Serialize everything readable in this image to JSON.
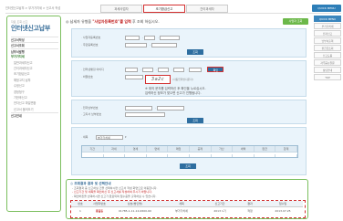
{
  "top": {
    "breadcrumb": "인터넷신고납부 > 부가가치세 > 신고서 작성",
    "tabs": [
      {
        "label": "과세사업자"
      },
      {
        "label": "조기환급신고"
      },
      {
        "label": "간이과세자"
      }
    ],
    "quick": "QUICK MENU"
  },
  "sidebar": {
    "subtitle": "자료 조회·신고",
    "title": "인터넷신고납부",
    "items": [
      {
        "label": "신고서작성",
        "kind": "group"
      },
      {
        "label": "신고서조회",
        "kind": "group"
      },
      {
        "label": "납부서발행",
        "kind": "group"
      },
      {
        "label": "부가가치세",
        "kind": "active"
      },
      {
        "label": "일반과세자신고",
        "kind": "sub"
      },
      {
        "label": "간이과세자신고",
        "kind": "sub"
      },
      {
        "label": "조기환급신고",
        "kind": "sub"
      },
      {
        "label": "예정고지 납부",
        "kind": "sub"
      },
      {
        "label": "수정신고",
        "kind": "sub"
      },
      {
        "label": "경정청구",
        "kind": "sub"
      },
      {
        "label": "기한후신고",
        "kind": "sub"
      },
      {
        "label": "전자신고 파일변환",
        "kind": "sub"
      },
      {
        "label": "신고서 불러오기",
        "kind": "sub"
      },
      {
        "label": "신고안내",
        "kind": "group"
      }
    ]
  },
  "main": {
    "header_prefix": "◎ 납세자 유형을 ",
    "header_highlight": "\"사업자등록번호\"를 입력",
    "header_suffix": " 후 조회 하십시오.",
    "header_button": "사업자 조회",
    "p1": {
      "row1_label": "· 사업자등록번호",
      "row2_label": "· 주민등록번호",
      "button": "조회"
    },
    "p2": {
      "row1_label": "· 인터넷뱅킹 아이디",
      "row2_label": "· 비밀번호",
      "confirm": "확인",
      "captcha": "3a2c",
      "captcha_note": "(자동입력방지문자)",
      "note_line1": "※ 위의 문자를 입력하신 후 확인을 누르십시오.",
      "note_line2": "입력하신 정보가 맞으면 신고가 진행됩니다."
    },
    "p3": {
      "row1_label": "· 전자납부번호",
      "row2_label": "· 고지서 납부번호",
      "button": "조회"
    },
    "p4": {
      "select_label": "· 세목",
      "select_value": "부가가치세",
      "columns": [
        "기간",
        "과세",
        "영세",
        "면세",
        "매입",
        "공제",
        "가산",
        "세액",
        "환급",
        "합계"
      ],
      "row": [
        "",
        "",
        "",
        "",
        "",
        "",
        "",
        "",
        "",
        ""
      ],
      "button": "조회"
    }
  },
  "info": {
    "title": "◎ 조회결과 결과 및 선택안내",
    "line1": "- 조회결과 중 신고하실 건을 선택하시면 신고서 작성 화면으로 이동합니다.",
    "line2": "- 신고기간 및 세목을 확인하신 후 신고서를 작성하여 주시기 바랍니다.",
    "line3": "- 확인버튼을 선택하시면 신고가 완료되며 접수증을 출력하실 수 있습니다.",
    "table_headers": [
      "번호",
      "사업자번호",
      "상호(법인명)",
      "세목",
      "신고기간",
      "결과",
      "접수일"
    ],
    "table_row": [
      "1",
      "홍길동",
      "01785-1-11-12-0600-60",
      "부가가치세",
      "2013 1기",
      "적정",
      "2013.07.25"
    ]
  },
  "rightnav": {
    "items": [
      "QUICK MENU",
      "부가가치세",
      "전자신고",
      "납부서출력",
      "환급금조회",
      "신고도움",
      "자주묻는질문",
      "상담안내",
      "TOP"
    ]
  }
}
